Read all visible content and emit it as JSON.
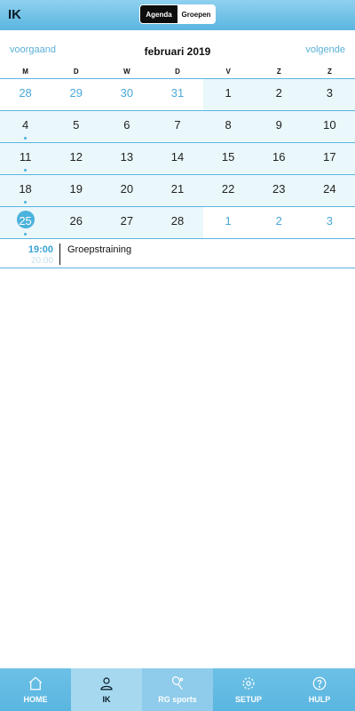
{
  "header": {
    "title": "IK",
    "segments": [
      {
        "label": "Agenda",
        "active": true
      },
      {
        "label": "Groepen",
        "active": false
      }
    ]
  },
  "calendar": {
    "prev_label": "voorgaand",
    "next_label": "volgende",
    "month_title": "februari 2019",
    "weekdays": [
      "M",
      "D",
      "W",
      "D",
      "V",
      "Z",
      "Z"
    ],
    "weeks": [
      [
        "28",
        "29",
        "30",
        "31",
        "1",
        "2",
        "3"
      ],
      [
        "4",
        "5",
        "6",
        "7",
        "8",
        "9",
        "10"
      ],
      [
        "11",
        "12",
        "13",
        "14",
        "15",
        "16",
        "17"
      ],
      [
        "18",
        "19",
        "20",
        "21",
        "22",
        "23",
        "24"
      ],
      [
        "25",
        "26",
        "27",
        "28",
        "1",
        "2",
        "3"
      ]
    ],
    "today": "25"
  },
  "events": [
    {
      "start": "19:00",
      "end": "20:00",
      "title": "Groepstraining"
    }
  ],
  "tabbar": {
    "items": [
      {
        "label": "HOME",
        "icon": "home-icon"
      },
      {
        "label": "IK",
        "icon": "person-icon"
      },
      {
        "label": "RG sports",
        "icon": "racket-icon"
      },
      {
        "label": "SETUP",
        "icon": "gear-icon"
      },
      {
        "label": "HULP",
        "icon": "help-icon"
      }
    ]
  },
  "colors": {
    "accent": "#5ab6e0",
    "light_cell": "#eaf7fb",
    "other_month_text": "#4aa8d8"
  }
}
